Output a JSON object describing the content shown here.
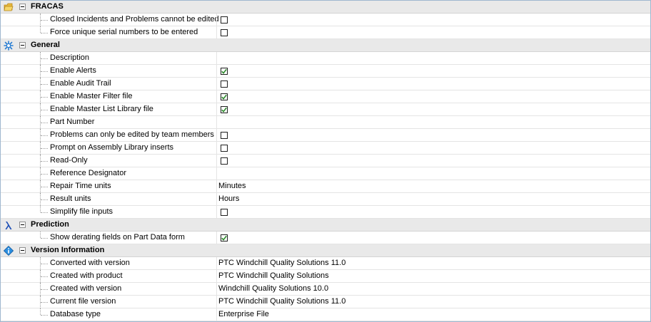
{
  "colors": {
    "category_bg": "#e9e9e9",
    "grid_line": "#e4e4e4",
    "check_mark": "#2e8b2e"
  },
  "categories": [
    {
      "label": "FRACAS",
      "icon": "folder-icon",
      "properties": [
        {
          "name": "Closed Incidents and Problems cannot be edited",
          "type": "checkbox",
          "checked": false
        },
        {
          "name": "Force unique serial numbers to be entered",
          "type": "checkbox",
          "checked": false
        }
      ]
    },
    {
      "label": "General",
      "icon": "gear-icon",
      "properties": [
        {
          "name": "Description",
          "type": "text",
          "value": ""
        },
        {
          "name": "Enable Alerts",
          "type": "checkbox",
          "checked": true
        },
        {
          "name": "Enable Audit Trail",
          "type": "checkbox",
          "checked": false
        },
        {
          "name": "Enable Master Filter file",
          "type": "checkbox",
          "checked": true
        },
        {
          "name": "Enable Master List Library file",
          "type": "checkbox",
          "checked": true
        },
        {
          "name": "Part Number",
          "type": "text",
          "value": ""
        },
        {
          "name": "Problems can only be edited by team members",
          "type": "checkbox",
          "checked": false
        },
        {
          "name": "Prompt on Assembly Library inserts",
          "type": "checkbox",
          "checked": false
        },
        {
          "name": "Read-Only",
          "type": "checkbox",
          "checked": false
        },
        {
          "name": "Reference Designator",
          "type": "text",
          "value": ""
        },
        {
          "name": "Repair Time units",
          "type": "text",
          "value": "Minutes"
        },
        {
          "name": "Result units",
          "type": "text",
          "value": "Hours"
        },
        {
          "name": "Simplify file inputs",
          "type": "checkbox",
          "checked": false
        }
      ]
    },
    {
      "label": "Prediction",
      "icon": "lambda-icon",
      "properties": [
        {
          "name": "Show derating fields on Part Data form",
          "type": "checkbox",
          "checked": true
        }
      ]
    },
    {
      "label": "Version Information",
      "icon": "info-icon",
      "properties": [
        {
          "name": "Converted with version",
          "type": "text",
          "value": "PTC Windchill Quality Solutions 11.0"
        },
        {
          "name": "Created with product",
          "type": "text",
          "value": "PTC Windchill Quality Solutions"
        },
        {
          "name": "Created with version",
          "type": "text",
          "value": "Windchill Quality Solutions 10.0"
        },
        {
          "name": "Current file version",
          "type": "text",
          "value": "PTC Windchill Quality Solutions 11.0"
        },
        {
          "name": "Database type",
          "type": "text",
          "value": "Enterprise File"
        }
      ]
    }
  ]
}
